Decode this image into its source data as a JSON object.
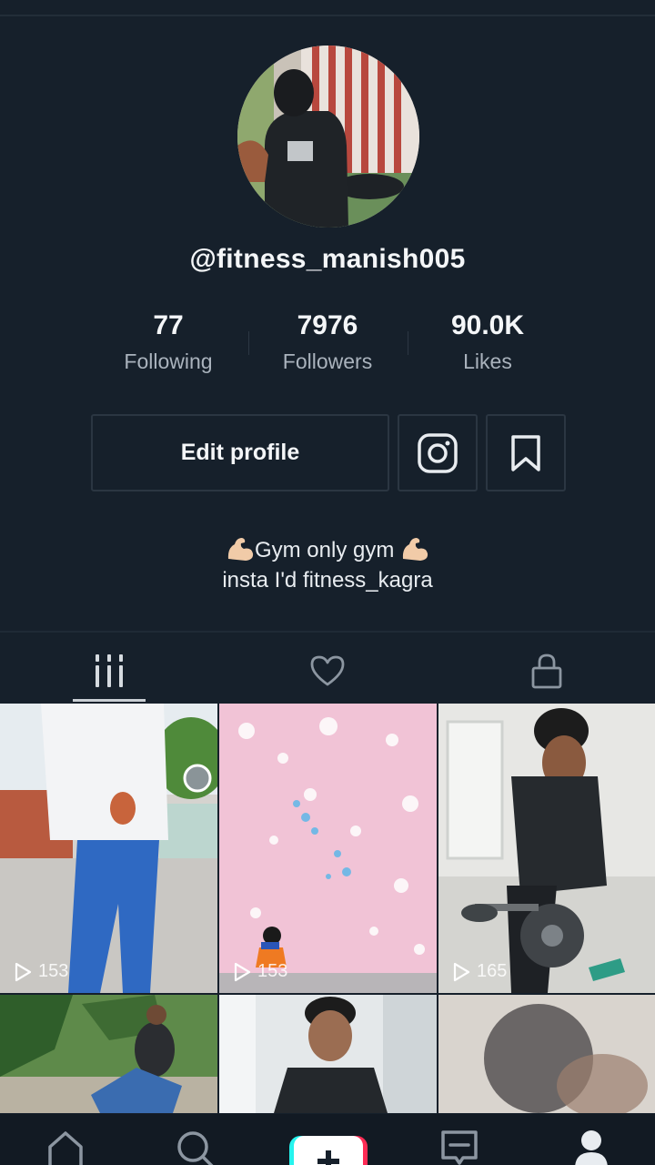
{
  "profile": {
    "username": "@fitness_manish005",
    "bio_line1": "Gym only  gym",
    "bio_line2": "insta I'd fitness_kagra"
  },
  "stats": [
    {
      "value": "77",
      "label": "Following"
    },
    {
      "value": "7976",
      "label": "Followers"
    },
    {
      "value": "90.0K",
      "label": "Likes"
    }
  ],
  "actions": {
    "edit_profile": "Edit profile"
  },
  "tabs": [
    {
      "icon": "grid-icon",
      "selected": true
    },
    {
      "icon": "heart-icon",
      "selected": false
    },
    {
      "icon": "lock-icon",
      "selected": false
    }
  ],
  "videos": [
    {
      "views": "153"
    },
    {
      "views": "153"
    },
    {
      "views": "165"
    },
    {
      "views": ""
    },
    {
      "views": ""
    },
    {
      "views": ""
    }
  ],
  "bottom_nav": [
    "home-icon",
    "search-icon",
    "plus-icon",
    "inbox-icon",
    "profile-icon"
  ],
  "colors": {
    "background": "#16202b",
    "accent_cyan": "#25f4ee",
    "accent_pink": "#fe2c55"
  }
}
